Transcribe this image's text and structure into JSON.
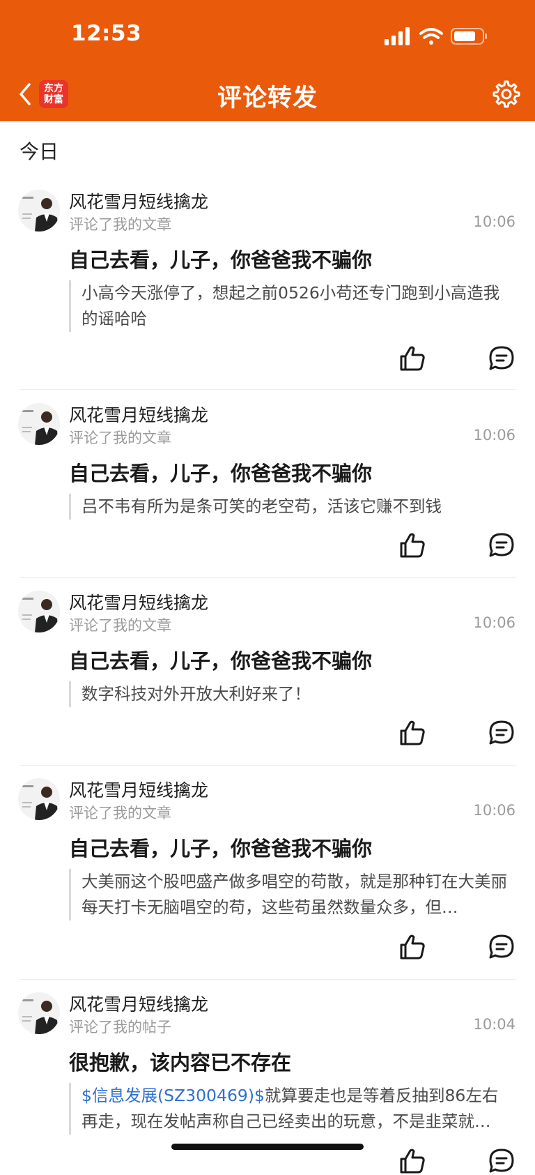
{
  "status_bar": {
    "time": "12:53"
  },
  "header": {
    "title": "评论转发",
    "logo_text": "东方财富",
    "accent_color": "#ea5a0b"
  },
  "section": {
    "title": "今日"
  },
  "notifications": [
    {
      "user": "风花雪月短线擒龙",
      "action": "评论了我的文章",
      "time": "10:06",
      "title": "自己去看，儿子，你爸爸我不骗你",
      "comment": "小高今天涨停了，想起之前0526小苟还专门跑到小高造我的谣哈哈"
    },
    {
      "user": "风花雪月短线擒龙",
      "action": "评论了我的文章",
      "time": "10:06",
      "title": "自己去看，儿子，你爸爸我不骗你",
      "comment": "吕不韦有所为是条可笑的老空苟，活该它赚不到钱"
    },
    {
      "user": "风花雪月短线擒龙",
      "action": "评论了我的文章",
      "time": "10:06",
      "title": "自己去看，儿子，你爸爸我不骗你",
      "comment": "数字科技对外开放大利好来了！"
    },
    {
      "user": "风花雪月短线擒龙",
      "action": "评论了我的文章",
      "time": "10:06",
      "title": "自己去看，儿子，你爸爸我不骗你",
      "comment": "大美丽这个股吧盛产做多唱空的苟散，就是那种钉在大美丽每天打卡无脑唱空的苟，这些苟虽然数量众多，但…"
    },
    {
      "user": "风花雪月短线擒龙",
      "action": "评论了我的帖子",
      "time": "10:04",
      "title": "很抱歉，该内容已不存在",
      "comment_link": "$信息发展(SZ300469)$",
      "comment": "就算要走也是等着反抽到86左右再走，现在发帖声称自己已经卖出的玩意，不是韭菜就…"
    }
  ]
}
